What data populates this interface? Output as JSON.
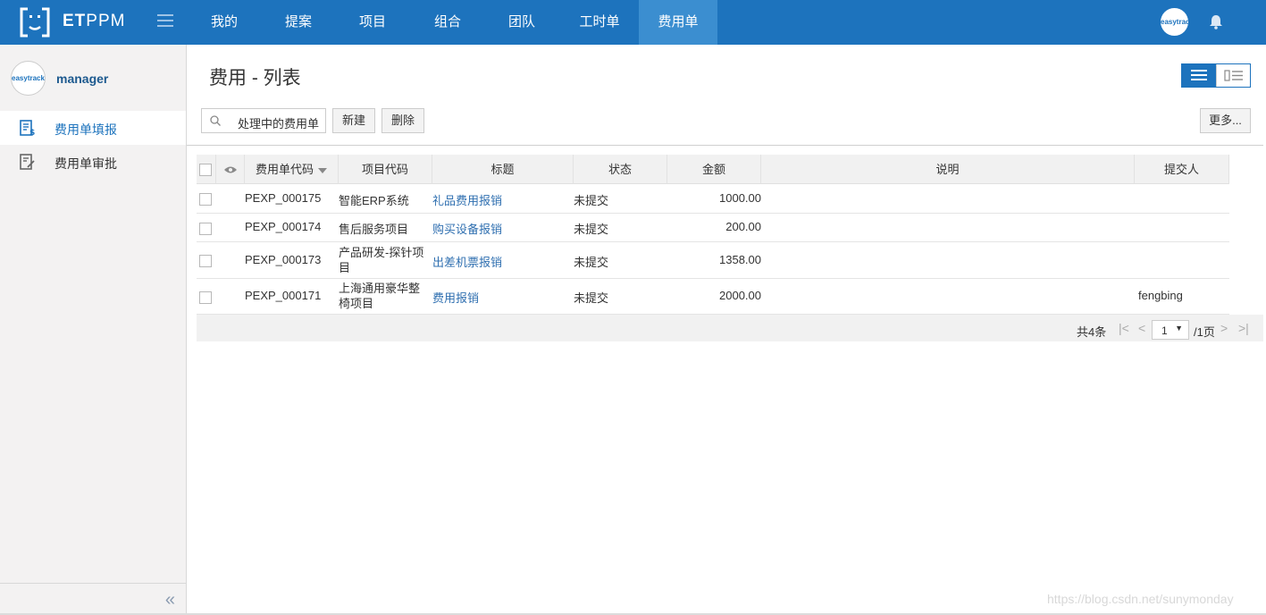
{
  "app": {
    "brand_bold": "ET",
    "brand_rest": "PPM",
    "avatar_text": "easytrack"
  },
  "nav": {
    "items": [
      {
        "label": "我的"
      },
      {
        "label": "提案"
      },
      {
        "label": "项目"
      },
      {
        "label": "组合"
      },
      {
        "label": "团队"
      },
      {
        "label": "工时单"
      },
      {
        "label": "费用单",
        "active": true
      }
    ]
  },
  "sidebar": {
    "username": "manager",
    "items": [
      {
        "label": "费用单填报",
        "active": true,
        "icon": "expense-form-icon"
      },
      {
        "label": "费用单审批",
        "active": false,
        "icon": "approval-icon"
      }
    ],
    "collapse_glyph": "«"
  },
  "main": {
    "title": "费用 - 列表",
    "search_value": "处理中的费用单",
    "new_label": "新建",
    "delete_label": "删除",
    "more_label": "更多..."
  },
  "table": {
    "columns": [
      "费用单代码",
      "项目代码",
      "标题",
      "状态",
      "金额",
      "说明",
      "提交人"
    ],
    "rows": [
      {
        "code": "PEXP_000175",
        "project": "智能ERP系统",
        "title": "礼品费用报销",
        "status": "未提交",
        "amount": "1000.00",
        "desc": "",
        "submitter": ""
      },
      {
        "code": "PEXP_000174",
        "project": "售后服务项目",
        "title": "购买设备报销",
        "status": "未提交",
        "amount": "200.00",
        "desc": "",
        "submitter": ""
      },
      {
        "code": "PEXP_000173",
        "project": "产品研发-探针项目",
        "title": "出差机票报销",
        "status": "未提交",
        "amount": "1358.00",
        "desc": "",
        "submitter": ""
      },
      {
        "code": "PEXP_000171",
        "project": "上海通用豪华整椅项目",
        "title": "费用报销",
        "status": "未提交",
        "amount": "2000.00",
        "desc": "",
        "submitter": "fengbing"
      }
    ]
  },
  "pager": {
    "total": "共4条",
    "page": "1",
    "pages": "/1页"
  },
  "watermark": "https://blog.csdn.net/sunymonday",
  "colors": {
    "primary": "#1d73bd",
    "nav_active": "#3b8ed0",
    "link": "#2f6fb0"
  }
}
